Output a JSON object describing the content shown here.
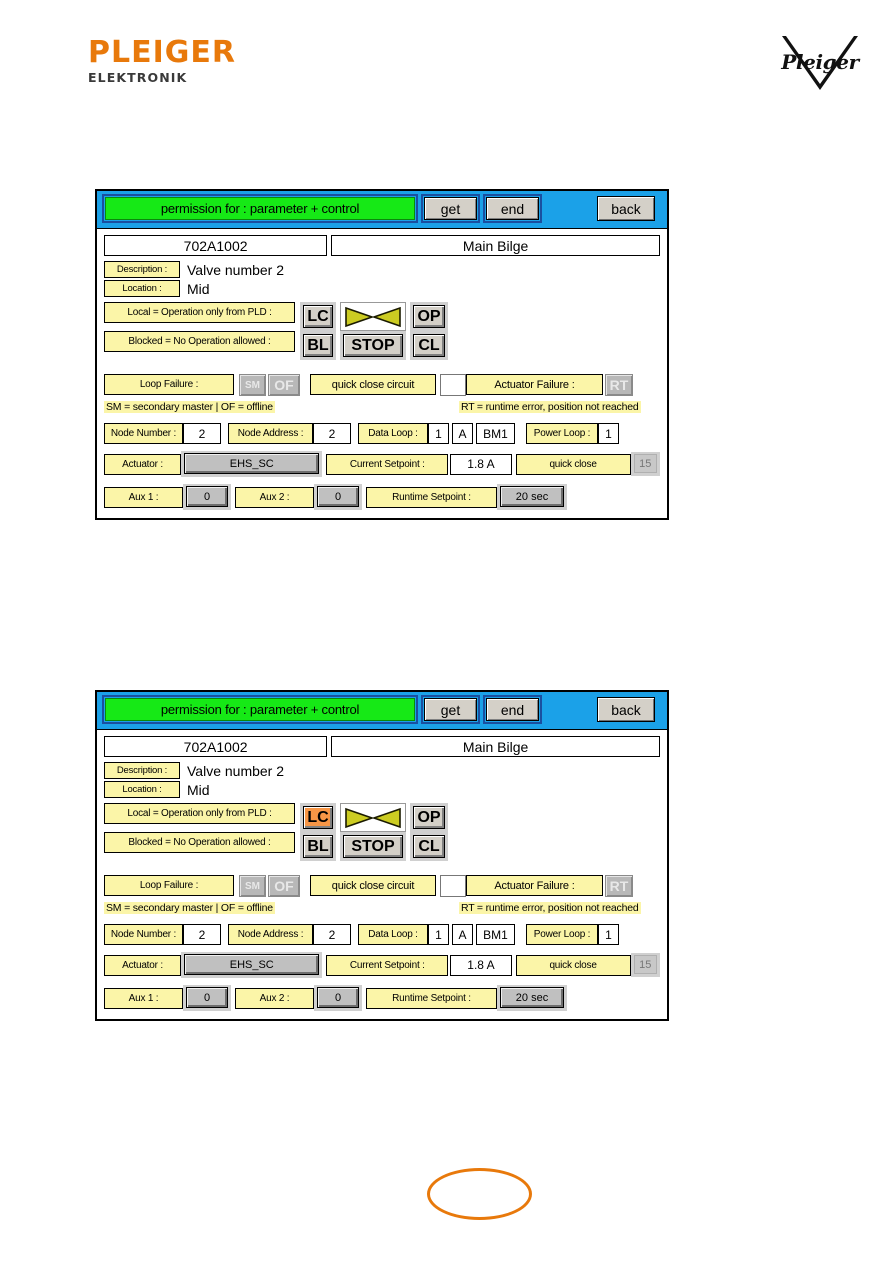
{
  "header": {
    "brand": "PLEIGER",
    "brand_sub": "ELEKTRONIK",
    "logo_script": "Pleiger",
    "brand_color": "#E8790B"
  },
  "panel": {
    "titlebar": {
      "permission_label": "permission for : parameter + control",
      "get_label": "get",
      "end_label": "end",
      "back_label": "back",
      "permission_color": "#16E916",
      "bar_color": "#1BA1E8"
    },
    "identity": {
      "tag": "702A1002",
      "location_name": "Main Bilge"
    },
    "info": {
      "description_label": "Description :",
      "description_value": "Valve number 2",
      "location_label": "Location :",
      "location_value": "Mid"
    },
    "modes": {
      "local_label": "Local = Operation only from PLD :",
      "blocked_label": "Blocked = No Operation allowed :",
      "lc_label": "LC",
      "bl_label": "BL",
      "op_label": "OP",
      "cl_label": "CL",
      "stop_label": "STOP",
      "valve_icon": "butterfly-valve-icon",
      "active_color": "#F79646"
    },
    "failures": {
      "loop_failure_label": "Loop Failure :",
      "sm_label": "SM",
      "of_label": "OF",
      "quick_close_circuit_label": "quick close circuit",
      "quick_close_circuit_checked": "",
      "actuator_failure_label": "Actuator Failure :",
      "rt_label": "RT",
      "legend_left": "SM = secondary master | OF = offline",
      "legend_right": "RT = runtime error, position not reached"
    },
    "data": {
      "node_number_label": "Node Number :",
      "node_number_value": "2",
      "node_address_label": "Node Address :",
      "node_address_value": "2",
      "data_loop_label": "Data Loop :",
      "data_loop_value": "1",
      "data_loop_letter": "A",
      "data_loop_bus": "BM1",
      "power_loop_label": "Power Loop :",
      "power_loop_value": "1",
      "actuator_label": "Actuator :",
      "actuator_value": "EHS_SC",
      "current_setpoint_label": "Current Setpoint :",
      "current_setpoint_value": "1.8 A",
      "quick_close_label": "quick close",
      "quick_close_value": "15",
      "aux1_label": "Aux 1 :",
      "aux1_value": "0",
      "aux2_label": "Aux 2 :",
      "aux2_value": "0",
      "runtime_setpoint_label": "Runtime Setpoint :",
      "runtime_setpoint_value": "20 sec"
    }
  },
  "panel1": {
    "lc_active": false
  },
  "panel2": {
    "lc_active": true
  },
  "annotation": {
    "ellipse_color": "#E8790B"
  }
}
